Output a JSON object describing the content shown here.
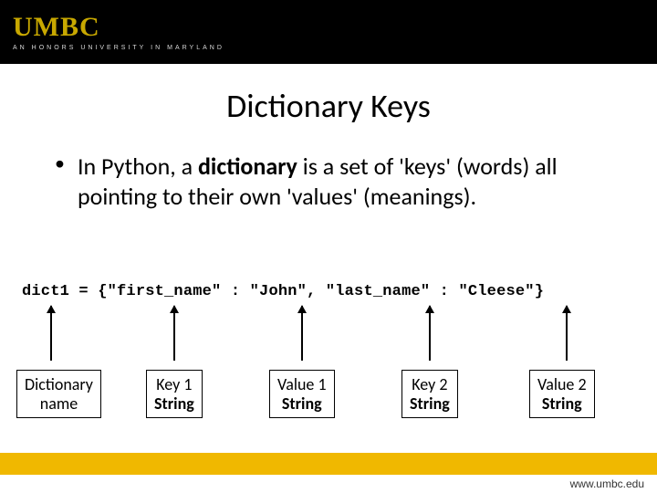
{
  "header": {
    "logo_main": "UMBC",
    "logo_sub": "AN HONORS UNIVERSITY IN MARYLAND"
  },
  "title": "Dictionary Keys",
  "bullet": {
    "pre": "In Python, a ",
    "bold": "dictionary",
    "post": " is a set of 'keys' (words) all pointing to their own 'values' (meanings)."
  },
  "code": "dict1 = {\"first_name\" : \"John\", \"last_name\" : \"Cleese\"}",
  "labels": {
    "l1a": "Dictionary",
    "l1b": "name",
    "l2a": "Key 1",
    "l2b": "String",
    "l3a": "Value 1",
    "l3b": "String",
    "l4a": "Key 2",
    "l4b": "String",
    "l5a": "Value 2",
    "l5b": "String"
  },
  "footer_url": "www.umbc.edu"
}
